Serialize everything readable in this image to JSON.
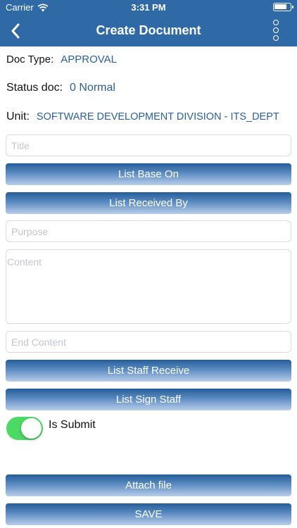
{
  "status_bar": {
    "carrier": "Carrier",
    "time": "3:31 PM"
  },
  "navbar": {
    "title": "Create Document",
    "back_icon": "chevron-left-icon",
    "more_icon": "vertical-dots-icon"
  },
  "doc_type": {
    "label": "Doc Type:",
    "value": "APPROVAL"
  },
  "status_doc": {
    "label": "Status doc:",
    "value": "0 Normal"
  },
  "unit": {
    "label": "Unit:",
    "value": "SOFTWARE DEVELOPMENT DIVISION - ITS_DEPT"
  },
  "fields": {
    "title_placeholder": "Title",
    "purpose_placeholder": "Purpose",
    "content_placeholder": "Content",
    "end_content_placeholder": "End Content"
  },
  "buttons": {
    "list_base_on": "List Base On",
    "list_received_by": "List Received By",
    "list_staff_receive": "List Staff Receive",
    "list_sign_staff": "List Sign Staff",
    "attach_file": "Attach file",
    "save": "SAVE"
  },
  "submit_toggle": {
    "label": "Is Submit",
    "on": true,
    "on_color": "#4cd964"
  },
  "colors": {
    "header": "#2f6aa6",
    "value_text": "#2a5f9a"
  }
}
